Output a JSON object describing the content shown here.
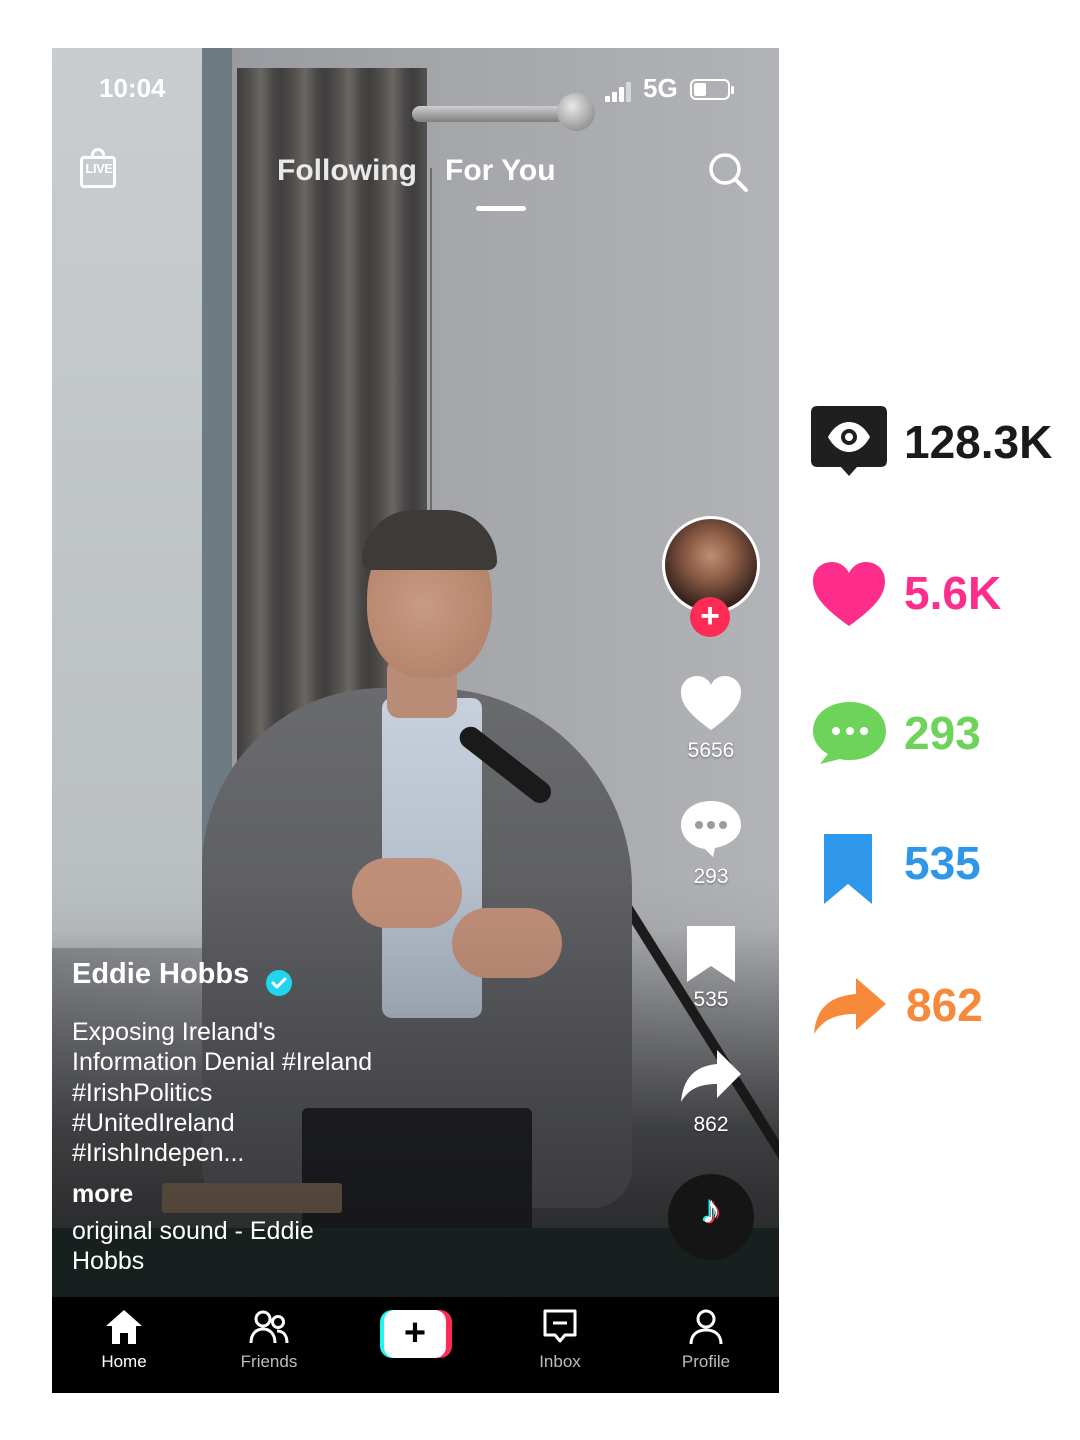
{
  "status_bar": {
    "time": "10:04",
    "network": "5G"
  },
  "top_bar": {
    "live_label": "LIVE",
    "tabs": [
      {
        "label": "Following"
      },
      {
        "label": "For You"
      }
    ],
    "active_tab": "For You"
  },
  "video": {
    "author": "Eddie Hobbs",
    "verified": true,
    "caption": "Exposing Ireland's\nInformation Denial #Ireland\n#IrishPolitics\n#UnitedIreland\n#IrishIndepen...",
    "more_label": "more",
    "sound": "original sound - Eddie Hobbs"
  },
  "actions": {
    "like_count": "5656",
    "comment_count": "293",
    "bookmark_count": "535",
    "share_count": "862"
  },
  "bottom_nav": {
    "items": [
      {
        "label": "Home",
        "icon": "home-icon"
      },
      {
        "label": "Friends",
        "icon": "friends-icon"
      },
      {
        "label": "create",
        "icon": "plus-icon"
      },
      {
        "label": "Inbox",
        "icon": "inbox-icon"
      },
      {
        "label": "Profile",
        "icon": "profile-icon"
      }
    ]
  },
  "stats": {
    "views": {
      "value": "128.3K",
      "icon": "eye-icon",
      "color": "#1a1a1a"
    },
    "likes": {
      "value": "5.6K",
      "icon": "heart-icon",
      "color": "#fe2c8a"
    },
    "comments": {
      "value": "293",
      "icon": "comment-icon",
      "color": "#6dd35a"
    },
    "saves": {
      "value": "535",
      "icon": "bookmark-icon",
      "color": "#2f97ea"
    },
    "shares": {
      "value": "862",
      "icon": "share-icon",
      "color": "#f7893b"
    }
  }
}
